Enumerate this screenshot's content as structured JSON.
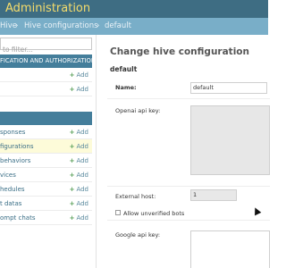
{
  "header": {
    "site_title": "Administration"
  },
  "breadcrumbs": {
    "home": "Hive",
    "section": "Hive configurations",
    "current": "default",
    "separator": "›"
  },
  "sidebar": {
    "filter_placeholder": "to filter...",
    "auth_caption": "FICATION AND AUTHORIZATION",
    "auth_items": [
      {
        "label": "",
        "add": "Add"
      },
      {
        "label": "",
        "add": "Add"
      }
    ],
    "app_items": [
      {
        "label": "sponses",
        "add": "Add"
      },
      {
        "label": "figurations",
        "add": "Add"
      },
      {
        "label": "behaviors",
        "add": "Add"
      },
      {
        "label": "vices",
        "add": "Add"
      },
      {
        "label": "hedules",
        "add": "Add"
      },
      {
        "label": "t datas",
        "add": "Add"
      },
      {
        "label": "ompt chats",
        "add": "Add"
      }
    ]
  },
  "main": {
    "page_title": "Change hive configuration",
    "object_name": "default",
    "fields": {
      "name_label": "Name:",
      "name_value": "default",
      "openai_label": "Openai api key:",
      "external_host_label": "External host:",
      "external_host_value": "1",
      "allow_unverified_label": "Allow unverified bots",
      "google_label": "Google api key:"
    }
  },
  "colors": {
    "header_bg": "#3e6d83",
    "site_title": "#f5dc6b",
    "breadcrumb_bg": "#79aec8",
    "caption_bg": "#447e9b",
    "active_row_bg": "#fdfbd9",
    "add_plus": "#5aa05a"
  },
  "icons": {
    "add": "plus-icon",
    "cursor": "mouse-pointer-icon"
  }
}
